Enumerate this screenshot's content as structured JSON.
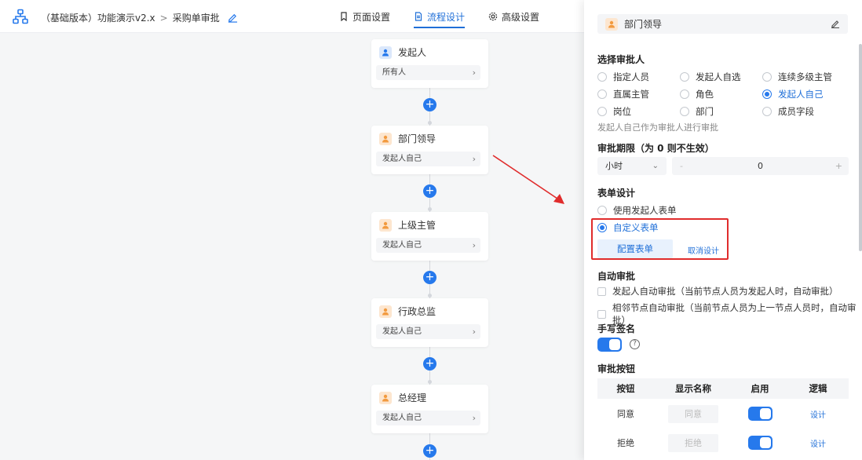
{
  "header": {
    "breadcrumb_app": "（基础版本）功能演示v2.x",
    "breadcrumb_sep": ">",
    "breadcrumb_page": "采购单审批",
    "tabs": [
      {
        "label": "页面设置",
        "icon": "bookmark-icon"
      },
      {
        "label": "流程设计",
        "icon": "document-icon",
        "active": true
      },
      {
        "label": "高级设置",
        "icon": "gear-icon"
      }
    ]
  },
  "flow": {
    "nodes": [
      {
        "title": "发起人",
        "value": "所有人",
        "icon": "user-icon",
        "icon_color": "#2679ec"
      },
      {
        "title": "部门领导",
        "value": "发起人自己",
        "icon": "approver-icon",
        "icon_color": "#f29a3f"
      },
      {
        "title": "上级主管",
        "value": "发起人自己",
        "icon": "approver-icon",
        "icon_color": "#f29a3f"
      },
      {
        "title": "行政总监",
        "value": "发起人自己",
        "icon": "approver-icon",
        "icon_color": "#f29a3f"
      },
      {
        "title": "总经理",
        "value": "发起人自己",
        "icon": "approver-icon",
        "icon_color": "#f29a3f"
      }
    ],
    "add_symbol": "+"
  },
  "panel": {
    "node_title": "部门领导",
    "approver_section": "选择审批人",
    "approver_options": [
      [
        "指定人员",
        "发起人自选",
        "连续多级主管"
      ],
      [
        "直属主管",
        "角色",
        "发起人自己"
      ],
      [
        "岗位",
        "部门",
        "成员字段"
      ]
    ],
    "approver_selected": "发起人自己",
    "approver_hint": "发起人自己作为审批人进行审批",
    "deadline_section": "审批期限（为 0 则不生效）",
    "deadline_unit": "小时",
    "deadline_value": "0",
    "deadline_minus": "-",
    "deadline_plus": "+",
    "form_section": "表单设计",
    "form_option_1": "使用发起人表单",
    "form_option_2": "自定义表单",
    "form_selected": "自定义表单",
    "configure_button": "配置表单",
    "cancel_design_link": "取消设计",
    "auto_section": "自动审批",
    "auto_option_1": "发起人自动审批（当前节点人员为发起人时，自动审批）",
    "auto_option_2": "相邻节点自动审批（当前节点人员为上一节点人员时，自动审批）",
    "signature_section": "手写签名",
    "signature_enabled": true,
    "help_symbol": "?",
    "buttons_section": "审批按钮",
    "table_headers": [
      "按钮",
      "显示名称",
      "启用",
      "逻辑"
    ],
    "table_rows": [
      {
        "button": "同意",
        "display": "同意",
        "enabled": true,
        "logic": "设计"
      },
      {
        "button": "拒绝",
        "display": "拒绝",
        "enabled": true,
        "logic": "设计"
      }
    ]
  },
  "colors": {
    "primary": "#2679ec",
    "annotation": "#e02c2c",
    "approver": "#f29a3f"
  }
}
